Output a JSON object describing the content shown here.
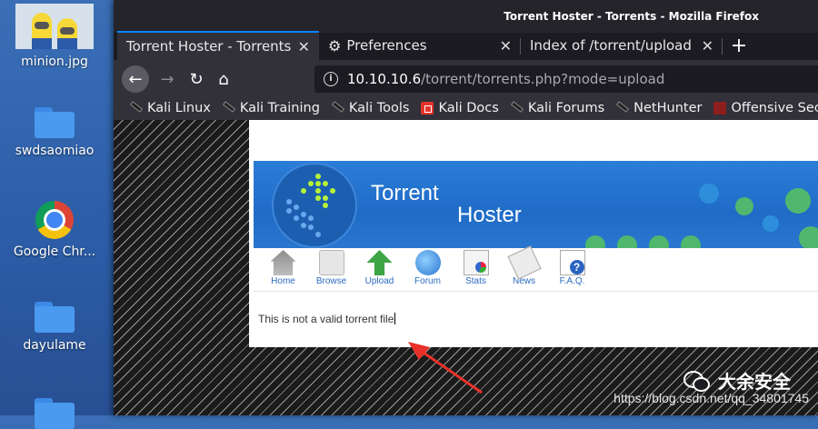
{
  "desktop": {
    "icons": [
      {
        "label": "minion.jpg"
      },
      {
        "label": "swdsaomiao"
      },
      {
        "label": "Google Chr..."
      },
      {
        "label": "dayulame"
      }
    ]
  },
  "window": {
    "title": "Torrent Hoster - Torrents - Mozilla Firefox",
    "tabs": [
      {
        "label": "Torrent Hoster - Torrents"
      },
      {
        "label": "Preferences"
      },
      {
        "label": "Index of /torrent/upload"
      }
    ],
    "new_tab_symbol": "+",
    "url": {
      "host": "10.10.10.6",
      "path": "/torrent/torrents.php?mode=upload"
    },
    "bookmarks": [
      {
        "label": "Kali Linux",
        "icon": "kali-dragon-icon"
      },
      {
        "label": "Kali Training",
        "icon": "kali-dragon-icon"
      },
      {
        "label": "Kali Tools",
        "icon": "kali-dragon-icon"
      },
      {
        "label": "Kali Docs",
        "icon": "kali-docs-icon"
      },
      {
        "label": "Kali Forums",
        "icon": "kali-dragon-icon"
      },
      {
        "label": "NetHunter",
        "icon": "kali-dragon-icon"
      },
      {
        "label": "Offensive Security",
        "icon": "offsec-icon"
      }
    ]
  },
  "page": {
    "banner": {
      "title_line1": "Torrent",
      "title_line2": "Hoster"
    },
    "nav": [
      {
        "label": "Home"
      },
      {
        "label": "Browse"
      },
      {
        "label": "Upload"
      },
      {
        "label": "Forum"
      },
      {
        "label": "Stats"
      },
      {
        "label": "News"
      },
      {
        "label": "F.A.Q."
      }
    ],
    "message": "This is not a valid torrent file"
  },
  "watermark": {
    "brand": "大余安全",
    "url": "https://blog.csdn.net/qq_34801745"
  },
  "colors": {
    "accent": "#0a84ff",
    "banner_blue": "#1f6cc7",
    "annotation_red": "#e8312a"
  }
}
